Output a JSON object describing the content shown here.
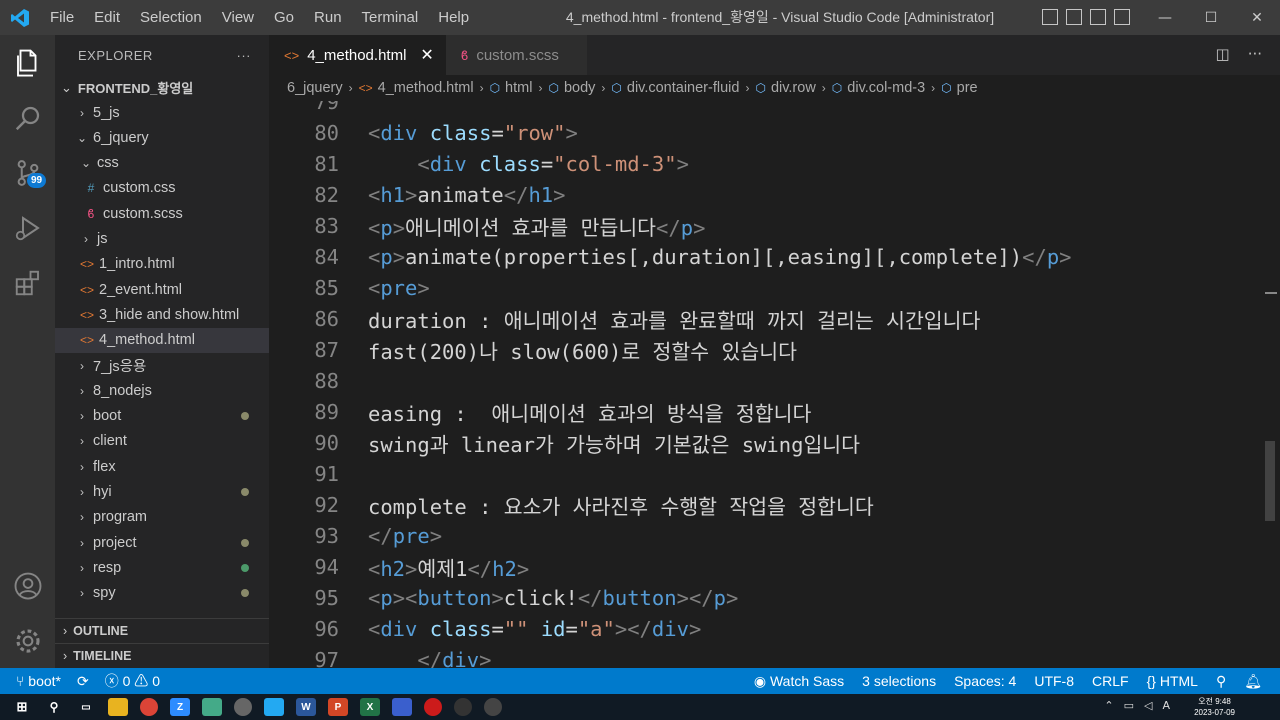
{
  "titlebar": {
    "menu": [
      "File",
      "Edit",
      "Selection",
      "View",
      "Go",
      "Run",
      "Terminal",
      "Help"
    ],
    "title": "4_method.html - frontend_황영일 - Visual Studio Code [Administrator]",
    "minimize": "—",
    "maximize": "☐",
    "close": "✕"
  },
  "activitybar": {
    "scm_badge": "99",
    "icons": [
      "files-icon",
      "search-icon",
      "source-control-icon",
      "run-debug-icon",
      "extensions-icon",
      "account-icon",
      "settings-gear-icon"
    ]
  },
  "sidebar": {
    "header": "EXPLORER",
    "more": "···",
    "root": "FRONTEND_황영일",
    "items": [
      {
        "label": "5_js",
        "type": "folder",
        "open": false,
        "depth": 1
      },
      {
        "label": "6_jquery",
        "type": "folder",
        "open": true,
        "depth": 1
      },
      {
        "label": "css",
        "type": "folder",
        "open": true,
        "depth": 2
      },
      {
        "label": "custom.css",
        "type": "css",
        "depth": 3
      },
      {
        "label": "custom.scss",
        "type": "scss",
        "depth": 3
      },
      {
        "label": "js",
        "type": "folder",
        "open": false,
        "depth": 2
      },
      {
        "label": "1_intro.html",
        "type": "html",
        "depth": 2
      },
      {
        "label": "2_event.html",
        "type": "html",
        "depth": 2
      },
      {
        "label": "3_hide and show.html",
        "type": "html",
        "depth": 2
      },
      {
        "label": "4_method.html",
        "type": "html",
        "depth": 2,
        "selected": true
      },
      {
        "label": "7_js응용",
        "type": "folder",
        "open": false,
        "depth": 1
      },
      {
        "label": "8_nodejs",
        "type": "folder",
        "open": false,
        "depth": 1
      },
      {
        "label": "boot",
        "type": "folder",
        "open": false,
        "depth": 1,
        "dot": "gray"
      },
      {
        "label": "client",
        "type": "folder",
        "open": false,
        "depth": 1
      },
      {
        "label": "flex",
        "type": "folder",
        "open": false,
        "depth": 1
      },
      {
        "label": "hyi",
        "type": "folder",
        "open": false,
        "depth": 1,
        "dot": "gray"
      },
      {
        "label": "program",
        "type": "folder",
        "open": false,
        "depth": 1
      },
      {
        "label": "project",
        "type": "folder",
        "open": false,
        "depth": 1,
        "dot": "gray"
      },
      {
        "label": "resp",
        "type": "folder",
        "open": false,
        "depth": 1,
        "dot": "green"
      },
      {
        "label": "spy",
        "type": "folder",
        "open": false,
        "depth": 1,
        "dot": "gray"
      }
    ],
    "outline": "OUTLINE",
    "timeline": "TIMELINE"
  },
  "tabs": [
    {
      "label": "4_method.html",
      "active": true,
      "icon": "html-icon"
    },
    {
      "label": "custom.scss",
      "active": false,
      "icon": "scss-icon"
    }
  ],
  "breadcrumb": [
    "6_jquery",
    "4_method.html",
    "html",
    "body",
    "div.container-fluid",
    "div.row",
    "div.col-md-3",
    "pre"
  ],
  "editor": {
    "lines": [
      {
        "n": "79",
        "code": ""
      },
      {
        "n": "80",
        "code": "<div class=\"row\">"
      },
      {
        "n": "81",
        "code": "    <div class=\"col-md-3\">"
      },
      {
        "n": "82",
        "code": "<h1>animate</h1>"
      },
      {
        "n": "83",
        "code": "<p>애니메이션 효과를 만듭니다</p>"
      },
      {
        "n": "84",
        "code": "<p>animate(properties[,duration][,easing][,complete])</p>"
      },
      {
        "n": "85",
        "code": "<pre>"
      },
      {
        "n": "86",
        "code": "duration : 애니메이션 효과를 완료할때 까지 걸리는 시간입니다"
      },
      {
        "n": "87",
        "code": "fast(200)나 slow(600)로 정할수 있습니다"
      },
      {
        "n": "88",
        "code": ""
      },
      {
        "n": "89",
        "code": "easing :  애니메이션 효과의 방식을 정합니다"
      },
      {
        "n": "90",
        "code": "swing과 linear가 가능하며 기본값은 swing입니다"
      },
      {
        "n": "91",
        "code": ""
      },
      {
        "n": "92",
        "code": "complete : 요소가 사라진후 수행할 작업을 정합니다"
      },
      {
        "n": "93",
        "code": "</pre>"
      },
      {
        "n": "94",
        "code": "<h2>예제1</h2>"
      },
      {
        "n": "95",
        "code": "<p><button>click!</button></p>"
      },
      {
        "n": "96",
        "code": "<div class=\"\" id=\"a\"></div>"
      },
      {
        "n": "97",
        "code": "    </div>"
      }
    ]
  },
  "statusbar": {
    "branch": "boot*",
    "errors": "0",
    "warnings": "0",
    "watch_sass": "Watch Sass",
    "selections": "3 selections",
    "spaces": "Spaces: 4",
    "encoding": "UTF-8",
    "eol": "CRLF",
    "language": "HTML"
  },
  "taskbar": {
    "clock_label": "오전 9:48",
    "date": "2023-07-09",
    "apps": [
      "start-icon",
      "search-icon",
      "task-view-icon",
      "file-explorer-icon",
      "chrome-icon",
      "zoom-icon",
      "app-icon",
      "app-icon",
      "vscode-icon",
      "word-icon",
      "powerpoint-icon",
      "excel-icon",
      "app-icon",
      "opera-icon",
      "app-icon",
      "app-icon"
    ]
  },
  "colors": {
    "accent": "#007acc",
    "tag": "#569cd6",
    "attr": "#9cdcfe",
    "string": "#ce9178"
  }
}
